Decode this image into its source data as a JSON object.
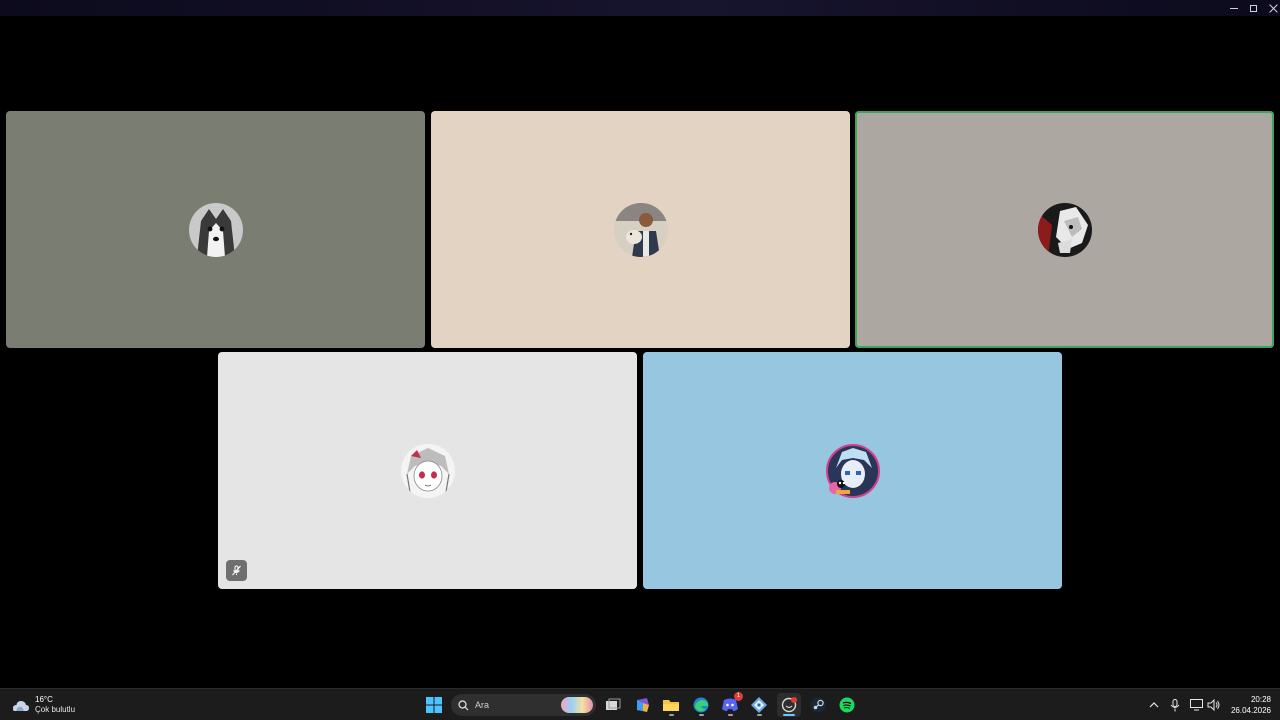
{
  "window": {
    "controls": [
      "minimize-icon",
      "maximize-icon",
      "close-icon"
    ]
  },
  "call": {
    "participants": [
      {
        "avatar": "husky-dog-avatar",
        "tile_color": "#7a7d72",
        "speaking": false,
        "muted": false
      },
      {
        "avatar": "man-holding-dog-avatar",
        "tile_color": "#e2d3c3",
        "speaking": false,
        "muted": false
      },
      {
        "avatar": "black-white-dog-avatar",
        "tile_color": "#aca8a1",
        "speaking": true,
        "muted": false
      },
      {
        "avatar": "anime-girl-sketch-avatar",
        "tile_color": "#e5e5e5",
        "speaking": false,
        "muted": true
      },
      {
        "avatar": "anime-boy-pixel-avatar",
        "tile_color": "#97c6e0",
        "speaking": false,
        "muted": false
      }
    ],
    "speaking_color": "#3ba55c"
  },
  "taskbar": {
    "weather": {
      "temp": "16°C",
      "desc": "Çok bulutlu",
      "icon": "cloud-icon"
    },
    "search": {
      "placeholder": "Ara",
      "icon": "search-icon"
    },
    "apps": [
      {
        "icon": "windows-start-icon"
      },
      {
        "icon": "task-view-icon"
      },
      {
        "icon": "microsoft-365-icon"
      },
      {
        "icon": "file-explorer-icon"
      },
      {
        "icon": "edge-icon"
      },
      {
        "icon": "discord-icon",
        "badge": "1"
      },
      {
        "icon": "app-icon"
      },
      {
        "icon": "active-app-icon"
      },
      {
        "icon": "steam-icon"
      },
      {
        "icon": "spotify-icon"
      }
    ],
    "tray": [
      "chevron-up-icon",
      "microphone-icon",
      "display-icon",
      "volume-icon"
    ],
    "clock": {
      "time": "20:28",
      "date": "26.04.2026"
    }
  }
}
